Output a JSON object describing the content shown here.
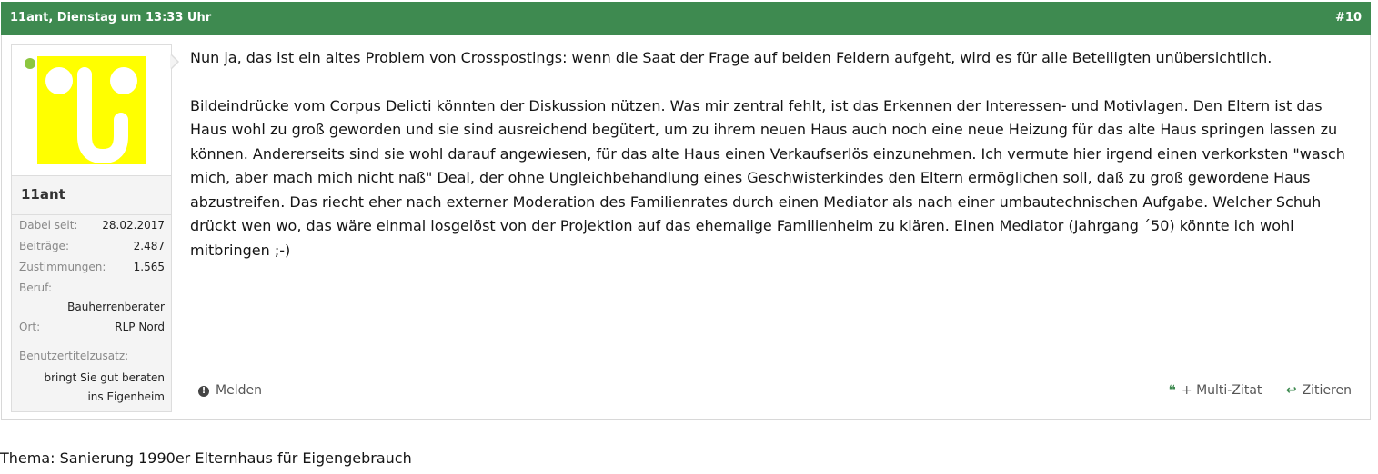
{
  "post": {
    "author_date": "11ant, Dienstag um 13:33 Uhr",
    "number": "#10",
    "header_color": "#3e8a50"
  },
  "user": {
    "name": "11ant",
    "online": true,
    "stats": {
      "since_label": "Dabei seit:",
      "since_value": "28.02.2017",
      "posts_label": "Beiträge:",
      "posts_value": "2.487",
      "likes_label": "Zustimmungen:",
      "likes_value": "1.565",
      "job_label": "Beruf:",
      "job_value": "Bauherrenberater",
      "place_label": "Ort:",
      "place_value": "RLP Nord",
      "title_extra_label": "Benutzertitelzusatz:",
      "title_extra_value_1": "bringt Sie gut beraten",
      "title_extra_value_2": "ins Eigenheim"
    }
  },
  "message": {
    "paragraph_1": "Nun ja, das ist ein altes Problem von Crosspostings: wenn die Saat der Frage auf beiden Feldern aufgeht, wird es für alle Beteiligten unübersichtlich.",
    "paragraph_2": "Bildeindrücke vom Corpus Delicti könnten der Diskussion nützen. Was mir zentral fehlt, ist das Erkennen der Interessen- und Motivlagen. Den Eltern ist das Haus wohl zu groß geworden und sie sind ausreichend begütert, um zu ihrem neuen Haus auch noch eine neue Heizung für das alte Haus springen lassen zu können. Andererseits sind sie wohl darauf angewiesen, für das alte Haus einen Verkaufserlös einzunehmen. Ich vermute hier irgend einen verkorksten \"wasch mich, aber mach mich nicht naß\" Deal, der ohne Ungleichbehandlung eines Geschwisterkindes den Eltern ermöglichen soll, daß zu groß gewordene Haus abzustreifen. Das riecht eher nach externer Moderation des Familienrates durch einen Mediator als nach einer umbautechnischen Aufgabe. Welcher Schuh drückt wen wo, das wäre einmal losgelöst von der Projektion auf das ehemalige Familienheim zu klären. Einen Mediator (Jahrgang ´50) könnte ich wohl mitbringen ;-)"
  },
  "actions": {
    "report": "Melden",
    "multi_quote": "+ Multi-Zitat",
    "quote": "Zitieren",
    "report_icon": "exclamation-icon",
    "multi_quote_icon": "quote-icon",
    "quote_icon": "reply-icon"
  },
  "thread": {
    "title": "Thema: Sanierung 1990er Elternhaus für Eigengebrauch"
  }
}
